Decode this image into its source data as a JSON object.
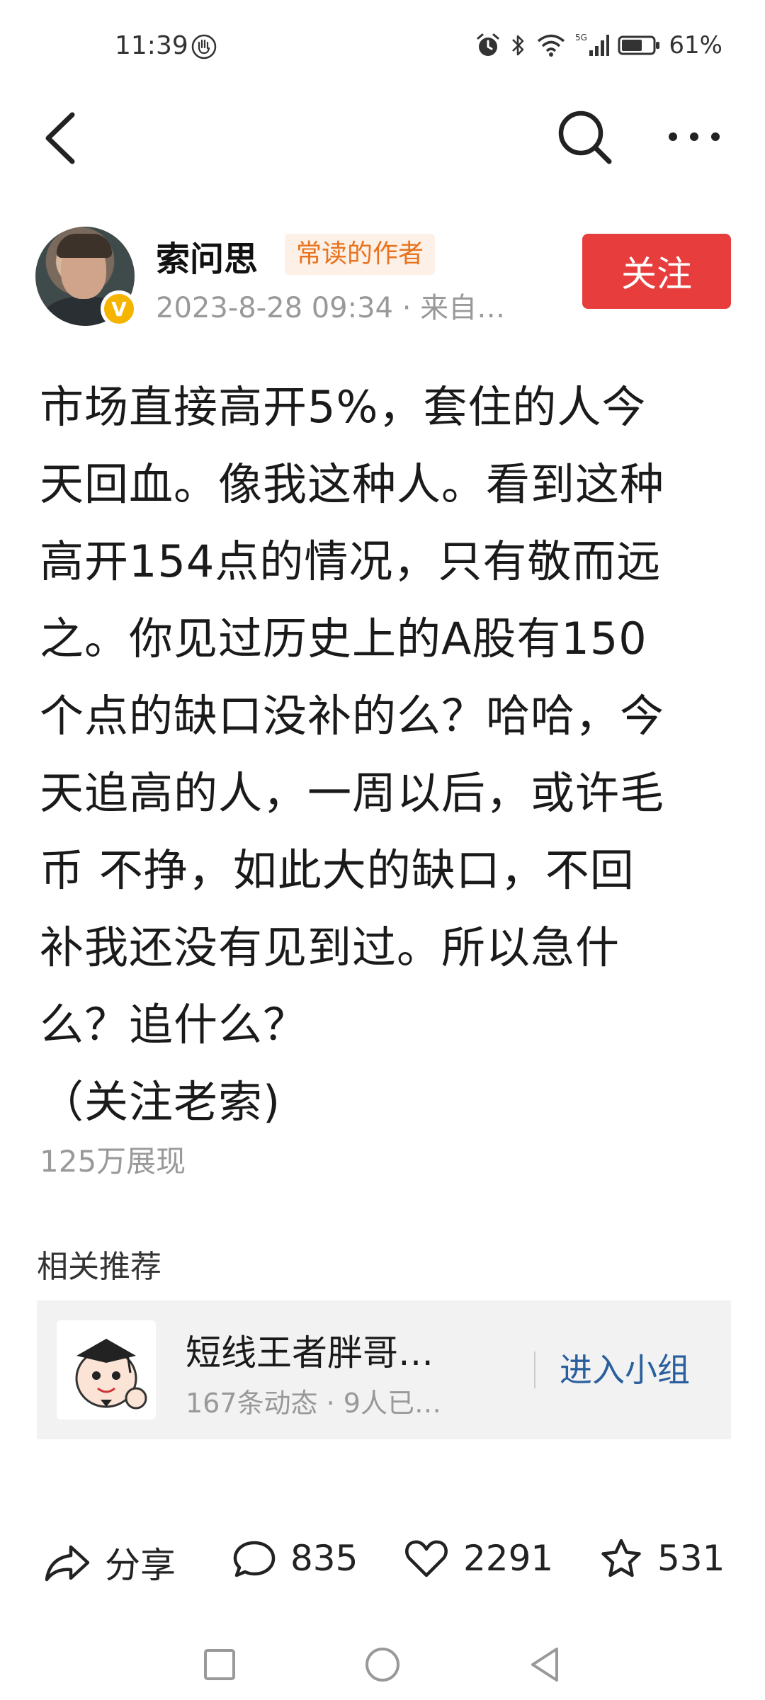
{
  "status_bar": {
    "time": "11:39",
    "battery": "61%",
    "icons": [
      "hand-icon",
      "alarm-icon",
      "bluetooth-icon",
      "wifi-icon",
      "signal-5g-icon",
      "battery-icon"
    ]
  },
  "nav": {
    "back_icon": "chevron-left-icon",
    "search_icon": "search-icon",
    "more_icon": "more-horizontal-icon"
  },
  "author": {
    "name": "索问思",
    "badge": "常读的作者",
    "meta": "2023-8-28 09:34 · 来自…",
    "verified": "V",
    "follow_label": "关注"
  },
  "post": {
    "lines": [
      "市场直接高开5%，套住的人今",
      "天回血。像我这种人。看到这种",
      "高开154点的情况，只有敬而远",
      "之。你见过历史上的A股有150",
      "个点的缺口没补的么？哈哈，今",
      "天追高的人，一周以后，或许毛",
      "币 不挣，如此大的缺口，不回",
      "补我还没有见到过。所以急什",
      "么？追什么？",
      "（关注老索)"
    ],
    "views": "125万展现"
  },
  "related": {
    "title": "相关推荐",
    "group_name": "短线王者胖哥…",
    "group_meta": "167条动态 · 9人已…",
    "enter_label": "进入小组"
  },
  "actions": {
    "share_label": "分享",
    "comments": "835",
    "likes": "2291",
    "favorites": "531"
  },
  "colors": {
    "follow_bg": "#e83d3d",
    "badge_text": "#e8731e",
    "badge_bg": "#fdf0e6",
    "link": "#2a5f9e",
    "muted": "#999999"
  }
}
